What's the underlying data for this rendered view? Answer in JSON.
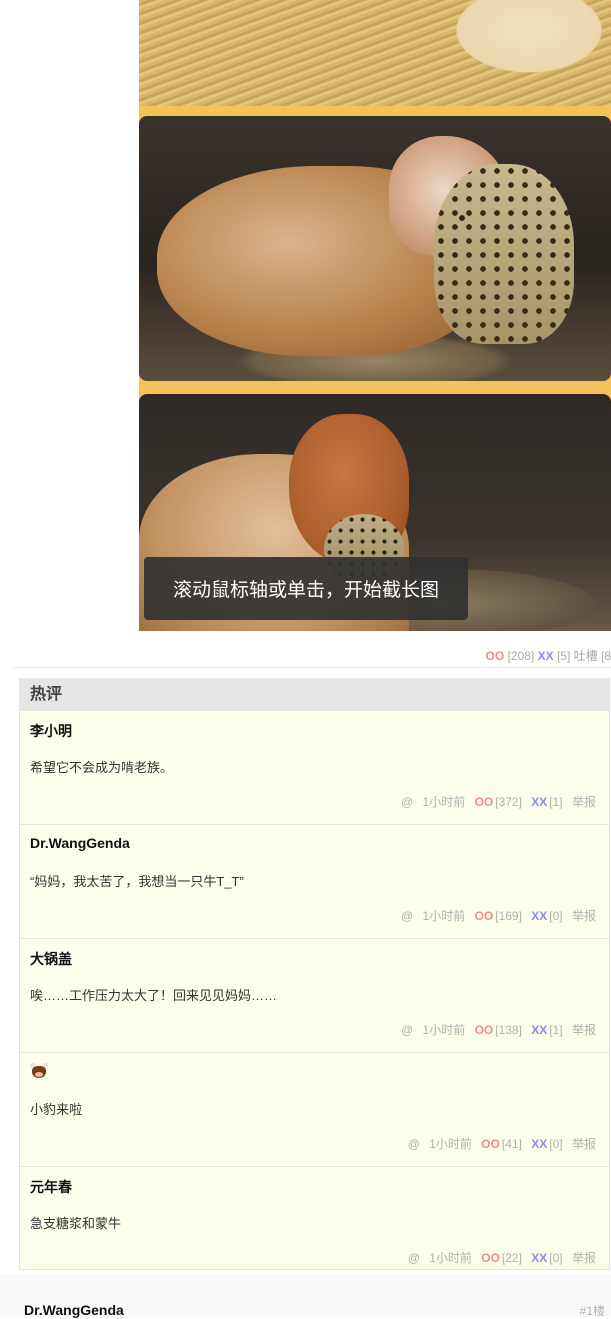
{
  "image": {
    "tooltip": "滚动鼠标轴或单击，开始截长图"
  },
  "post_votes": {
    "oo_label": "OO",
    "oo_count": "[208]",
    "xx_label": "XX",
    "xx_count": "[5]",
    "tucao_label": "吐槽 [8"
  },
  "hot": {
    "title": "热评",
    "comments": [
      {
        "author": "李小明",
        "text": "希望它不会成为啃老族。",
        "at": "@",
        "time": "1小时前",
        "oo": "OO",
        "oo_count": "[372]",
        "xx": "XX",
        "xx_count": "[1]",
        "report": "举报"
      },
      {
        "author": "Dr.WangGenda",
        "text": "“妈妈，我太苦了，我想当一只牛T_T”",
        "at": "@",
        "time": "1小时前",
        "oo": "OO",
        "oo_count": "[169]",
        "xx": "XX",
        "xx_count": "[0]",
        "report": "举报"
      },
      {
        "author": "大锅盖",
        "text": "唉……工作压力太大了！回来见见妈妈……",
        "at": "@",
        "time": "1小时前",
        "oo": "OO",
        "oo_count": "[138]",
        "xx": "XX",
        "xx_count": "[1]",
        "report": "举报"
      },
      {
        "author_icon": "cow-face-icon",
        "text": "小豹来啦",
        "at": "@",
        "time": "1小时前",
        "oo": "OO",
        "oo_count": "[41]",
        "xx": "XX",
        "xx_count": "[0]",
        "report": "举报"
      },
      {
        "author": "元年春",
        "text": "急支糖浆和蒙牛",
        "at": "@",
        "time": "1小时前",
        "oo": "OO",
        "oo_count": "[22]",
        "xx": "XX",
        "xx_count": "[0]",
        "report": "举报"
      }
    ]
  },
  "next_comment": {
    "author": "Dr.WangGenda",
    "floor": "#1楼"
  },
  "colors": {
    "oo": "#f08c8c",
    "xx": "#8d8cf0",
    "hot_bg": "#fdfdec",
    "hot_header_bg": "#e5e5e5"
  }
}
